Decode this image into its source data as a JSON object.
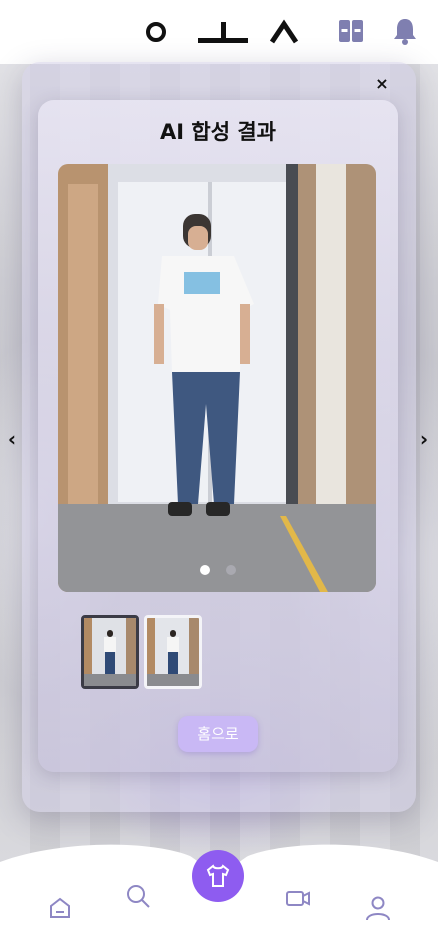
{
  "header": {
    "logo_icon": "logo-glyphs",
    "icons": [
      "book-icon",
      "bell-icon"
    ],
    "accent": "#8e87c4"
  },
  "modal": {
    "title": "AI 합성 결과",
    "close_label": "×",
    "prev_label": "‹",
    "next_label": "›",
    "carousel": {
      "count": 2,
      "active": 0
    },
    "thumbnails": [
      {
        "selected": true
      },
      {
        "selected": false
      }
    ],
    "home_button": "홈으로",
    "button_color": "#c9b8f5"
  },
  "navbar": {
    "items": [
      "home-icon",
      "search-icon",
      "shirt-icon",
      "camera-icon",
      "user-icon"
    ],
    "active": "shirt-icon",
    "active_color": "#8e5cf0"
  }
}
